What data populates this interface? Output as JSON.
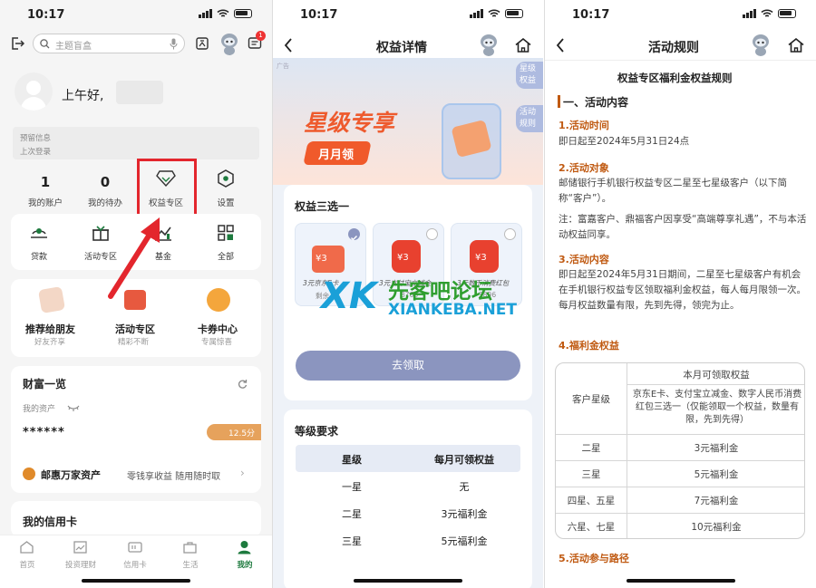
{
  "status": {
    "time": "10:17"
  },
  "phone1": {
    "search_placeholder": "主题盲盒",
    "badge": "1",
    "greeting": "上午好,",
    "reserve_info": "预留信息",
    "last_login": "上次登录",
    "stats": [
      {
        "num": "1",
        "label": "我的账户"
      },
      {
        "num": "0",
        "label": "我的待办"
      },
      {
        "label": "权益专区"
      },
      {
        "label": "设置"
      }
    ],
    "grid": [
      {
        "label": "贷款"
      },
      {
        "label": "活动专区"
      },
      {
        "label": "基金"
      },
      {
        "label": "全部"
      }
    ],
    "promos": [
      {
        "title": "推荐给朋友",
        "sub": "好友齐享"
      },
      {
        "title": "活动专区",
        "sub": "精彩不断"
      },
      {
        "title": "卡券中心",
        "sub": "专属惊喜"
      }
    ],
    "wealth": {
      "title": "财富一览",
      "my_assets": "我的资产",
      "masked": "******",
      "score": "12.5分"
    },
    "youhui": {
      "title": "邮惠万家资产",
      "desc": "零钱享收益 随用随时取"
    },
    "credit_title": "我的信用卡",
    "tabs": [
      {
        "label": "首页"
      },
      {
        "label": "投资理财"
      },
      {
        "label": "信用卡"
      },
      {
        "label": "生活"
      },
      {
        "label": "我的"
      }
    ],
    "accent": "#1d7a3e"
  },
  "phone2": {
    "title": "权益详情",
    "ad": "广告",
    "side_btns": [
      "星级权益",
      "活动规则"
    ],
    "banner_title": "星级专享",
    "banner_sub": "月月领",
    "choose_title": "权益三选一",
    "choices": [
      {
        "label": "3元京东E卡",
        "coin": "¥3",
        "status": "剩余"
      },
      {
        "label": "3元支付宝立减金",
        "coin": "¥3",
        "status": "8768"
      },
      {
        "label": "3元数币消费红包",
        "coin": "¥3",
        "status": "5896"
      }
    ],
    "button": "去领取",
    "level_title": "等级要求",
    "table_head": [
      "星级",
      "每月可领权益"
    ],
    "table_rows": [
      [
        "一星",
        "无"
      ],
      [
        "二星",
        "3元福利金"
      ],
      [
        "三星",
        "5元福利金"
      ]
    ],
    "button_color": "#8b95bf"
  },
  "phone3": {
    "title": "活动规则",
    "rule_title": "权益专区福利金权益规则",
    "section1": "一、活动内容",
    "items": [
      {
        "head": "1.活动时间",
        "body": "即日起至2024年5月31日24点"
      },
      {
        "head": "2.活动对象",
        "body": "邮储银行手机银行权益专区二星至七星级客户（以下简称“客户”）。",
        "note": "注：富嘉客户、鼎福客户因享受“高端尊享礼遇”，不与本活动权益同享。"
      },
      {
        "head": "3.活动内容",
        "body": "即日起至2024年5月31日期间，二星至七星级客户有机会在手机银行权益专区领取福利金权益，每人每月限领一次。每月权益数量有限，先到先得，领完为止。"
      },
      {
        "head": "4.福利金权益"
      }
    ],
    "table": {
      "col1": "客户星级",
      "col2_title": "本月可领取权益",
      "col2_desc": "京东E卡、支付宝立减金、数字人民币消费红包三选一（仅能领取一个权益，数量有限，先到先得）",
      "rows": [
        [
          "二星",
          "3元福利金"
        ],
        [
          "三星",
          "5元福利金"
        ],
        [
          "四星、五星",
          "7元福利金"
        ],
        [
          "六星、七星",
          "10元福利金"
        ]
      ]
    },
    "section5": "5.活动参与路径"
  },
  "watermark": {
    "cn": "先客吧论坛",
    "en": "XIANKEBA.NET"
  }
}
